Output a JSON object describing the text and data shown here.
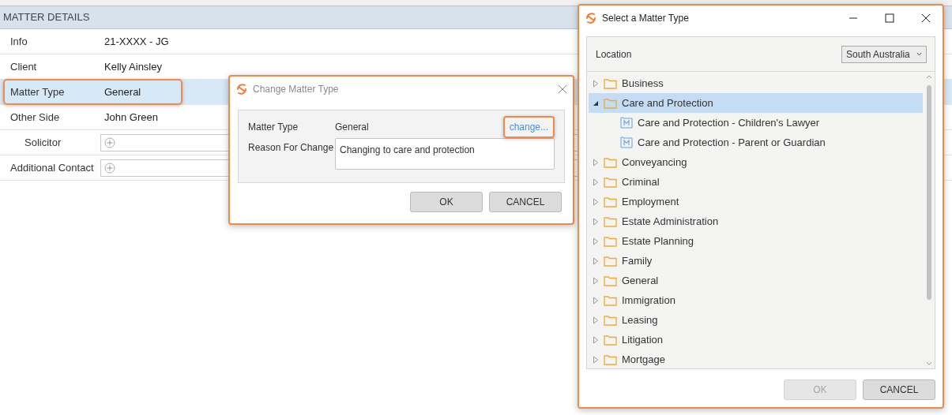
{
  "matter_details": {
    "title": "MATTER DETAILS",
    "rows": [
      {
        "label": "Info",
        "value": "21-XXXX - JG",
        "kind": "text",
        "selected": false,
        "highlighted": false
      },
      {
        "label": "Client",
        "value": "Kelly Ainsley",
        "kind": "text",
        "selected": false,
        "highlighted": false
      },
      {
        "label": "Matter Type",
        "value": "General",
        "kind": "text",
        "selected": true,
        "highlighted": true
      },
      {
        "label": "Other Side",
        "value": "John Green",
        "kind": "text",
        "selected": false,
        "highlighted": false
      },
      {
        "label": "Solicitor",
        "kind": "add_field",
        "indented": true,
        "selected": false,
        "highlighted": false
      },
      {
        "label": "Additional Contact",
        "kind": "add_field",
        "selected": false,
        "highlighted": false
      }
    ]
  },
  "change_dialog": {
    "title": "Change Matter Type",
    "matter_type_label": "Matter Type",
    "matter_type_value": "General",
    "change_link": "change...",
    "change_highlighted": true,
    "reason_label": "Reason For Change",
    "reason_value": "Changing to care and protection",
    "buttons": [
      {
        "label": "OK",
        "disabled": false
      },
      {
        "label": "CANCEL",
        "disabled": false
      }
    ]
  },
  "select_dialog": {
    "title": "Select a Matter Type",
    "location_label": "Location",
    "location_value": "South Australia",
    "tree": [
      {
        "label": "Business",
        "kind": "folder",
        "expanded": false,
        "selected": false
      },
      {
        "label": "Care and Protection",
        "kind": "folder",
        "expanded": true,
        "selected": true,
        "children": [
          {
            "label": "Care and Protection - Children's Lawyer",
            "kind": "matter_type",
            "selected": false
          },
          {
            "label": "Care and Protection - Parent or Guardian",
            "kind": "matter_type",
            "selected": false
          }
        ]
      },
      {
        "label": "Conveyancing",
        "kind": "folder",
        "expanded": false,
        "selected": false
      },
      {
        "label": "Criminal",
        "kind": "folder",
        "expanded": false,
        "selected": false
      },
      {
        "label": "Employment",
        "kind": "folder",
        "expanded": false,
        "selected": false
      },
      {
        "label": "Estate Administration",
        "kind": "folder",
        "expanded": false,
        "selected": false
      },
      {
        "label": "Estate Planning",
        "kind": "folder",
        "expanded": false,
        "selected": false
      },
      {
        "label": "Family",
        "kind": "folder",
        "expanded": false,
        "selected": false
      },
      {
        "label": "General",
        "kind": "folder",
        "expanded": false,
        "selected": false
      },
      {
        "label": "Immigration",
        "kind": "folder",
        "expanded": false,
        "selected": false
      },
      {
        "label": "Leasing",
        "kind": "folder",
        "expanded": false,
        "selected": false
      },
      {
        "label": "Litigation",
        "kind": "folder",
        "expanded": false,
        "selected": false
      },
      {
        "label": "Mortgage",
        "kind": "folder",
        "expanded": false,
        "selected": false
      }
    ],
    "buttons": [
      {
        "label": "OK",
        "disabled": true
      },
      {
        "label": "CANCEL",
        "disabled": false
      }
    ]
  }
}
